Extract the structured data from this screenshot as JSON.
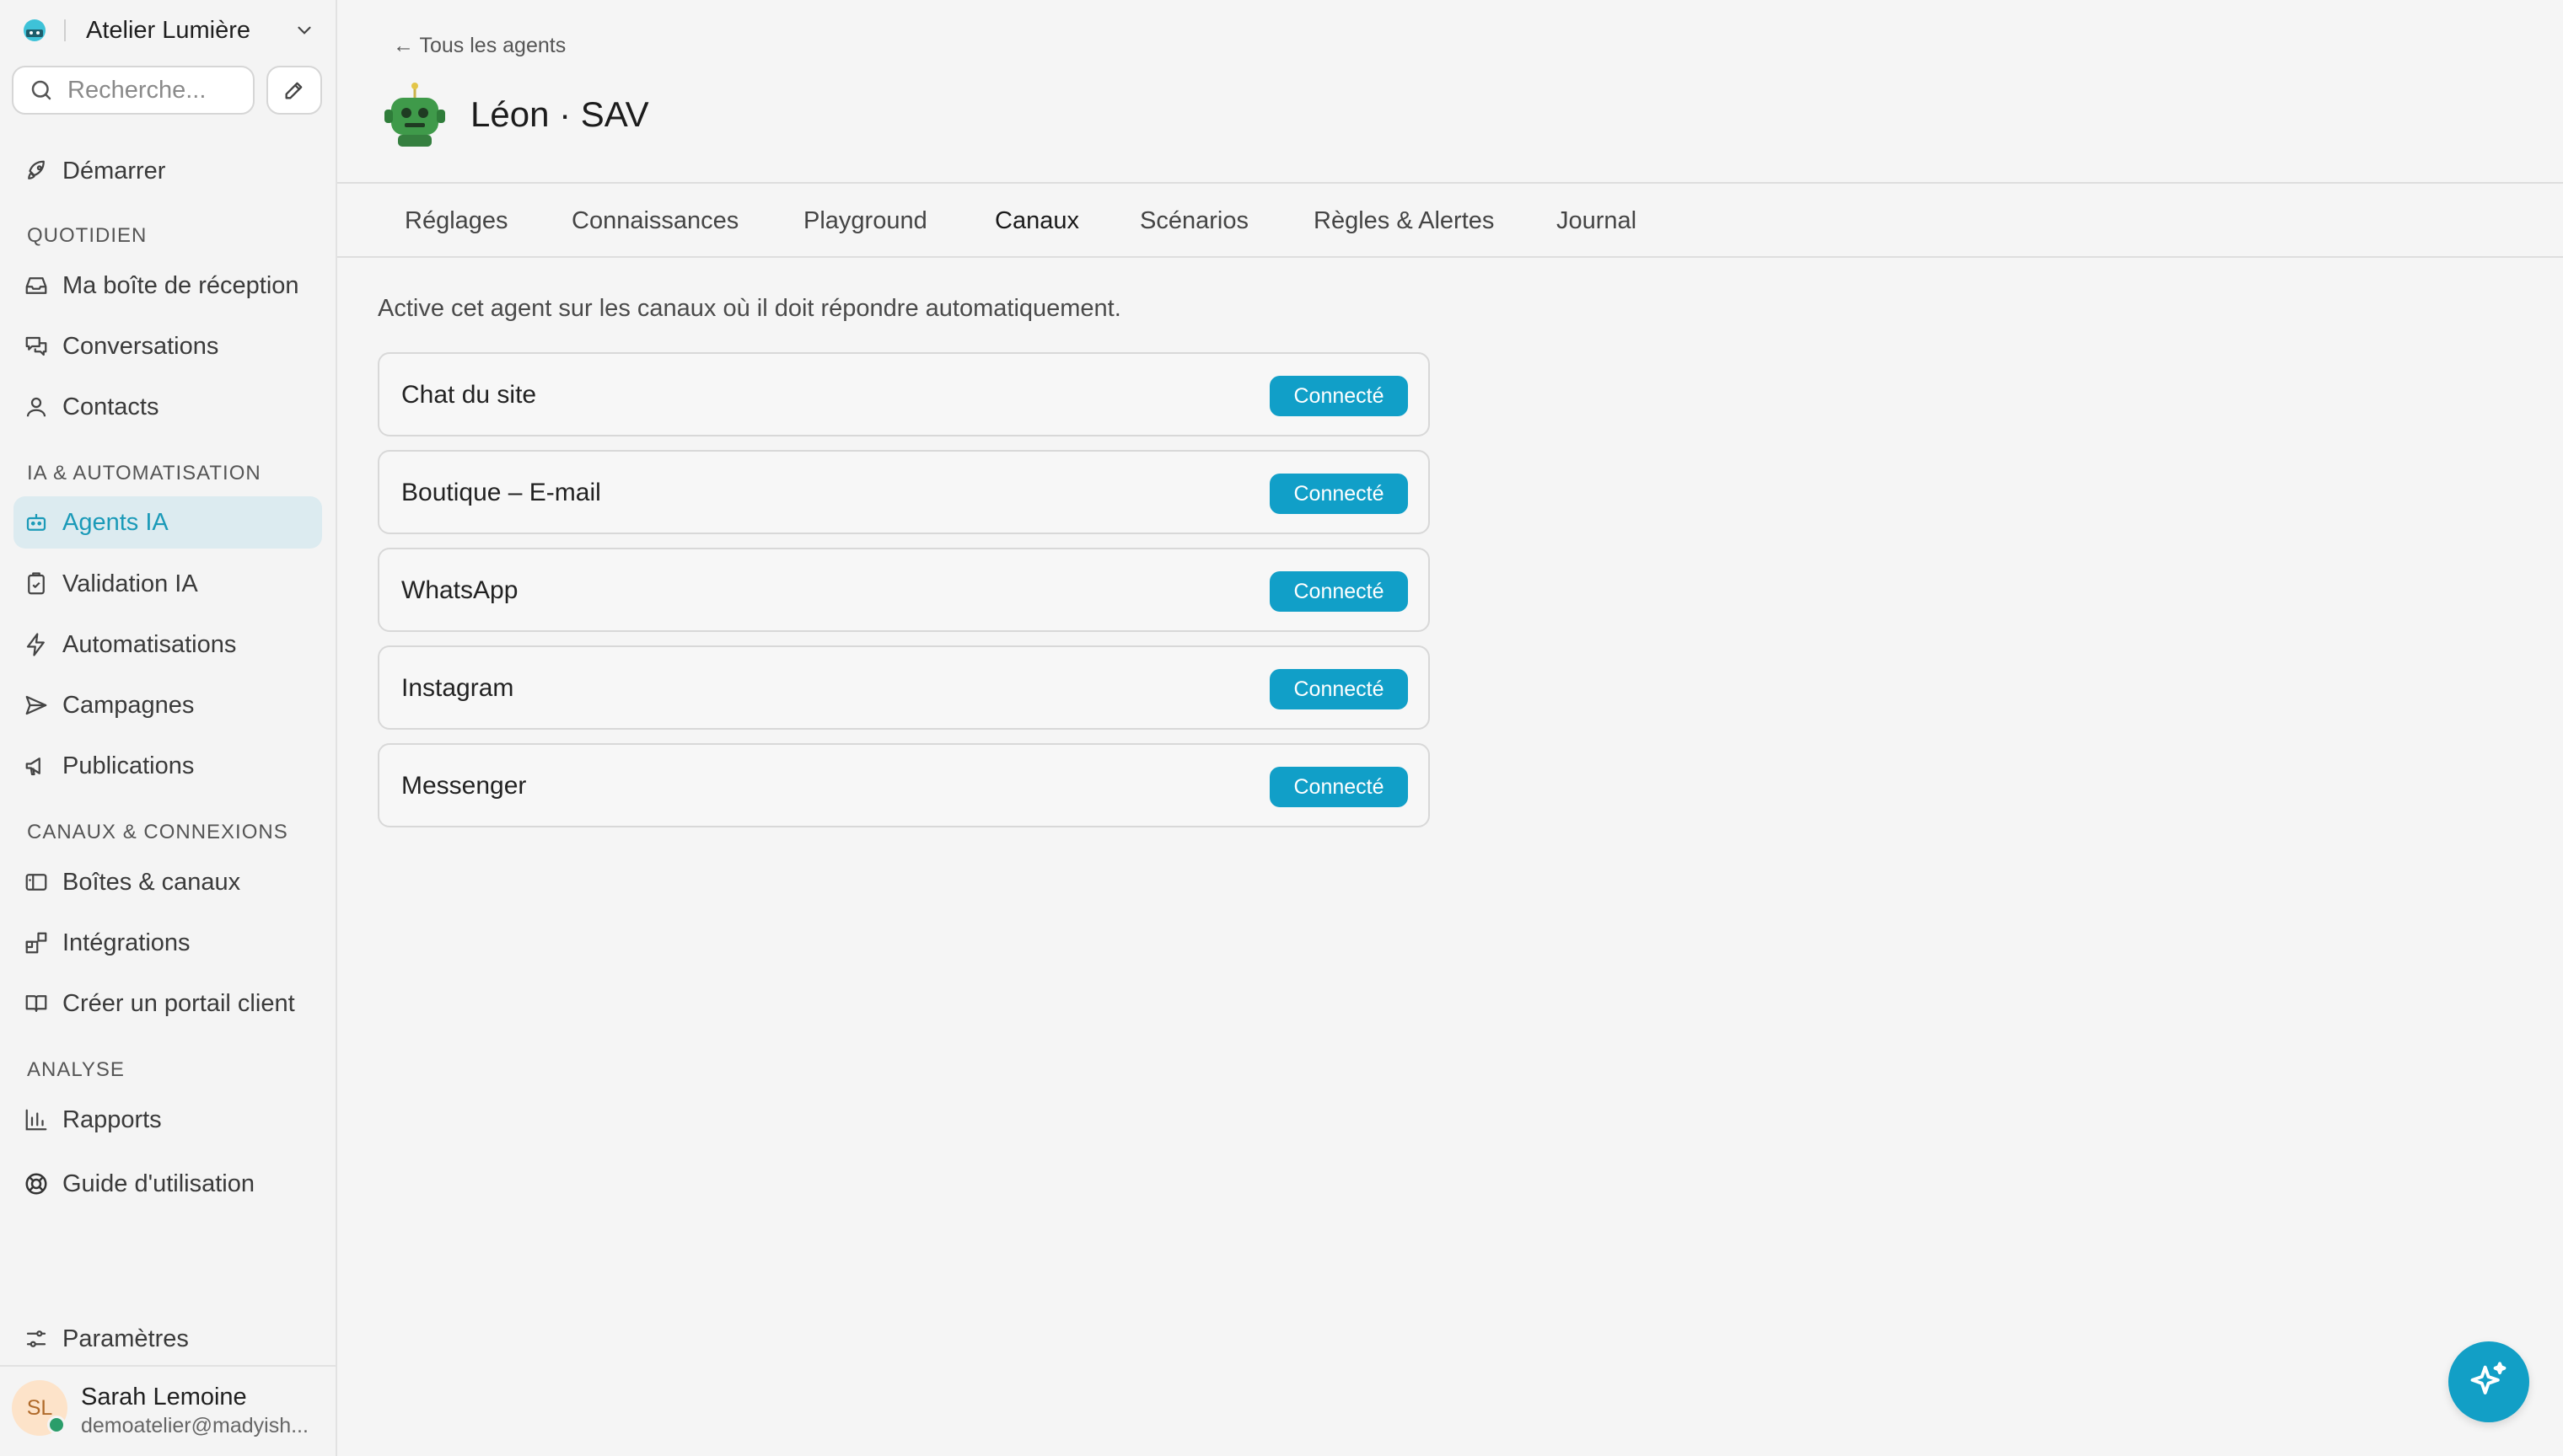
{
  "workspace": {
    "name": "Atelier Lumière"
  },
  "search": {
    "placeholder": "Recherche..."
  },
  "sidebar": {
    "start": "Démarrer",
    "sections": {
      "daily": "QUOTIDIEN",
      "ai": "IA & AUTOMATISATION",
      "channels": "CANAUX & CONNEXIONS",
      "analysis": "ANALYSE"
    },
    "items": {
      "inbox": "Ma boîte de réception",
      "conversations": "Conversations",
      "contacts": "Contacts",
      "agents": "Agents IA",
      "validation": "Validation IA",
      "automations": "Automatisations",
      "campaigns": "Campagnes",
      "publications": "Publications",
      "inboxes": "Boîtes & canaux",
      "integrations": "Intégrations",
      "portal": "Créer un portail client",
      "reports": "Rapports",
      "guide": "Guide d'utilisation",
      "settings": "Paramètres"
    }
  },
  "user": {
    "initials": "SL",
    "name": "Sarah Lemoine",
    "email": "demoatelier@madyish..."
  },
  "header": {
    "back": "← Tous les agents",
    "title": "Léon · SAV"
  },
  "tabs": [
    {
      "label": "Réglages"
    },
    {
      "label": "Connaissances"
    },
    {
      "label": "Playground"
    },
    {
      "label": "Canaux",
      "active": true
    },
    {
      "label": "Scénarios"
    },
    {
      "label": "Règles & Alertes"
    },
    {
      "label": "Journal"
    }
  ],
  "content": {
    "description": "Active cet agent sur les canaux où il doit répondre automatiquement.",
    "channels": [
      {
        "name": "Chat du site",
        "status": "Connecté"
      },
      {
        "name": "Boutique – E-mail",
        "status": "Connecté"
      },
      {
        "name": "WhatsApp",
        "status": "Connecté"
      },
      {
        "name": "Instagram",
        "status": "Connecté"
      },
      {
        "name": "Messenger",
        "status": "Connecté"
      }
    ]
  },
  "colors": {
    "accent": "#119fc8",
    "active_nav_bg": "#dcebf0"
  }
}
